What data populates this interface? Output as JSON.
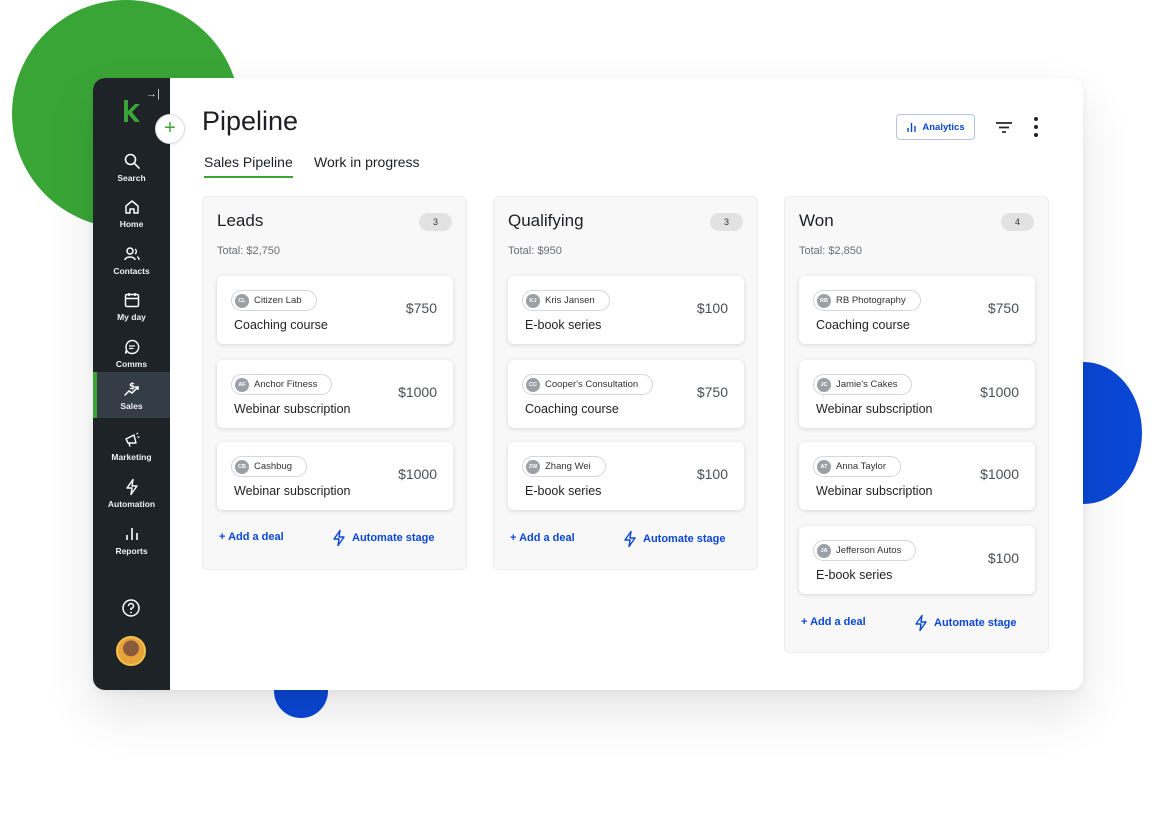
{
  "header": {
    "title": "Pipeline",
    "add_symbol": "+",
    "analytics_label": "Analytics"
  },
  "tabs": [
    {
      "label": "Sales Pipeline",
      "active": true
    },
    {
      "label": "Work in progress",
      "active": false
    }
  ],
  "sidebar": {
    "collapse_symbol": "→|",
    "items": [
      {
        "label": "Search",
        "icon": "search-icon"
      },
      {
        "label": "Home",
        "icon": "home-icon"
      },
      {
        "label": "Contacts",
        "icon": "contacts-icon"
      },
      {
        "label": "My day",
        "icon": "calendar-icon"
      },
      {
        "label": "Comms",
        "icon": "chat-icon"
      },
      {
        "label": "Sales",
        "icon": "sales-icon",
        "active": true
      },
      {
        "label": "Marketing",
        "icon": "megaphone-icon"
      },
      {
        "label": "Automation",
        "icon": "lightning-icon"
      },
      {
        "label": "Reports",
        "icon": "reports-icon"
      }
    ]
  },
  "columns": [
    {
      "title": "Leads",
      "count": "3",
      "total": "Total: $2,750",
      "deals": [
        {
          "initials": "CL",
          "contact": "Citizen Lab",
          "name": "Coaching course",
          "amount": "$750"
        },
        {
          "initials": "AF",
          "contact": "Anchor Fitness",
          "name": "Webinar subscription",
          "amount": "$1000"
        },
        {
          "initials": "CB",
          "contact": "Cashbug",
          "name": "Webinar subscription",
          "amount": "$1000"
        }
      ],
      "add_label": "+ Add a deal",
      "automate_label": "Automate stage"
    },
    {
      "title": "Qualifying",
      "count": "3",
      "total": "Total: $950",
      "deals": [
        {
          "initials": "KJ",
          "contact": "Kris Jansen",
          "name": "E-book series",
          "amount": "$100"
        },
        {
          "initials": "CC",
          "contact": "Cooper's Consultation",
          "name": "Coaching course",
          "amount": "$750"
        },
        {
          "initials": "ZW",
          "contact": "Zhang Wei",
          "name": "E-book series",
          "amount": "$100"
        }
      ],
      "add_label": "+ Add a deal",
      "automate_label": "Automate stage"
    },
    {
      "title": "Won",
      "count": "4",
      "total": "Total: $2,850",
      "deals": [
        {
          "initials": "RB",
          "contact": "RB Photography",
          "name": "Coaching course",
          "amount": "$750"
        },
        {
          "initials": "JC",
          "contact": "Jamie's Cakes",
          "name": "Webinar subscription",
          "amount": "$1000"
        },
        {
          "initials": "AT",
          "contact": "Anna Taylor",
          "name": "Webinar subscription",
          "amount": "$1000"
        },
        {
          "initials": "JA",
          "contact": "Jefferson Autos",
          "name": "E-book series",
          "amount": "$100"
        }
      ],
      "add_label": "+ Add a deal",
      "automate_label": "Automate stage"
    }
  ]
}
